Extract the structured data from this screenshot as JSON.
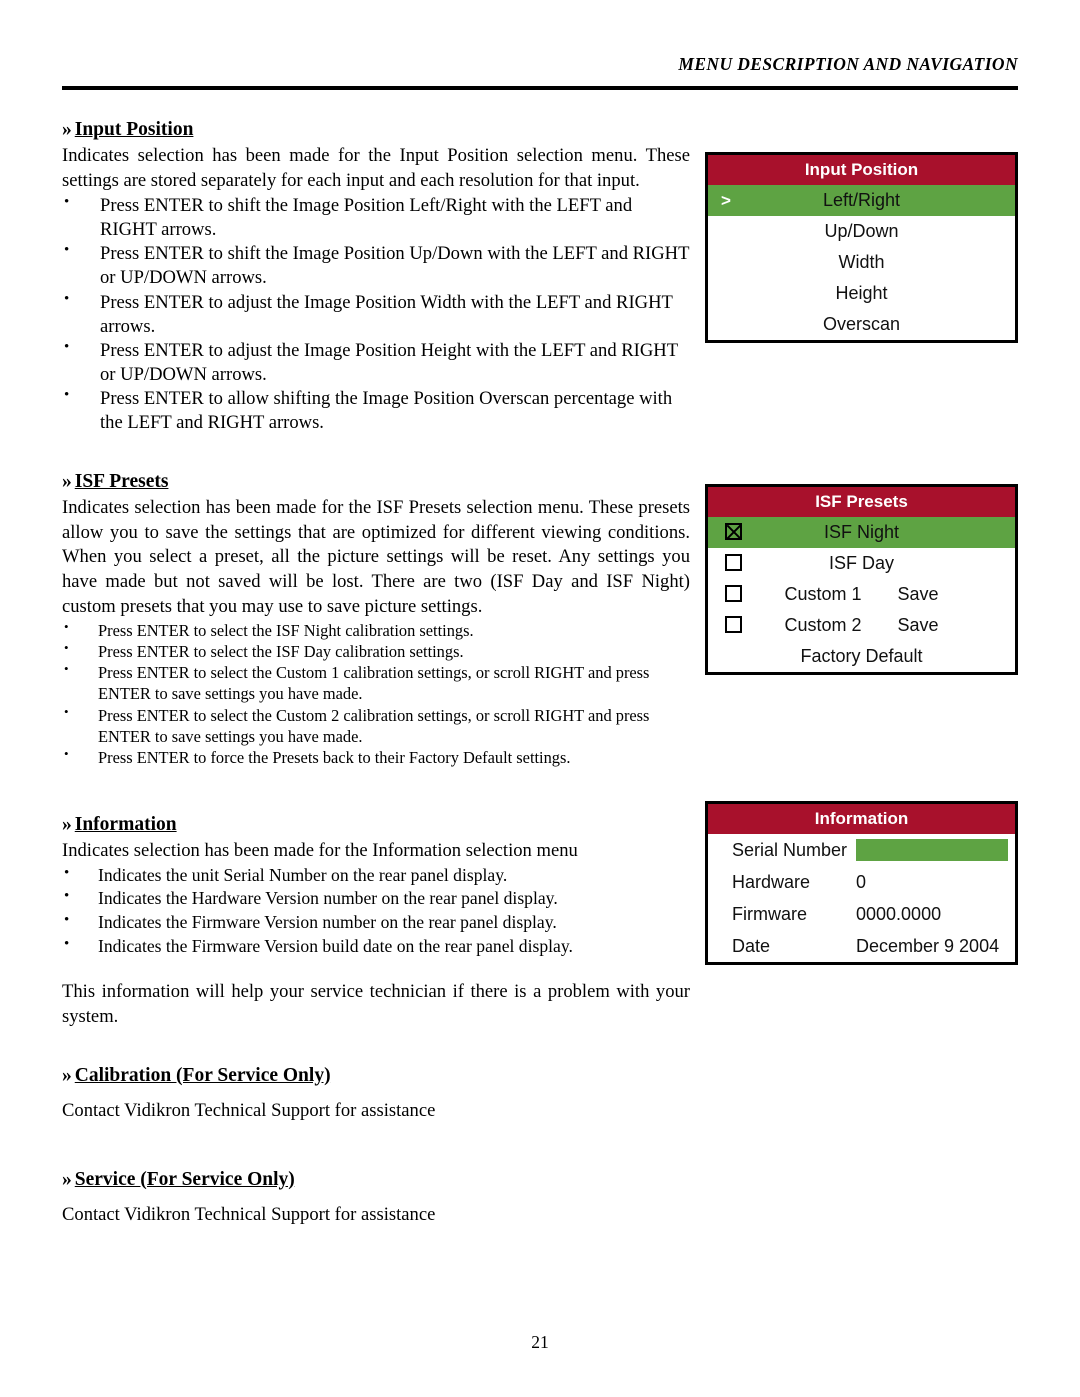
{
  "header": {
    "running_head": "MENU DESCRIPTION AND NAVIGATION"
  },
  "page_number": "21",
  "colors": {
    "osd_title_bg": "#A8112C",
    "osd_selected_bg": "#5EA343",
    "osd_border": "#000000",
    "text": "#000000"
  },
  "sections": {
    "input_position": {
      "guillemet": "»",
      "heading": "Input Position",
      "intro": "Indicates selection has been made for the Input Position selection menu. These settings are stored separately for each input and each resolution for that input.",
      "bullets": [
        "Press ENTER to shift the Image Position Left/Right with the LEFT and RIGHT arrows.",
        "Press ENTER to shift the Image Position Up/Down with the LEFT and RIGHT or UP/DOWN arrows.",
        "Press ENTER to adjust the Image Position Width with the LEFT and RIGHT arrows.",
        "Press ENTER to adjust the Image Position Height with the LEFT and RIGHT or UP/DOWN arrows.",
        "Press ENTER to allow shifting the Image Position Overscan percentage with the LEFT and RIGHT arrows."
      ]
    },
    "isf_presets": {
      "guillemet": "»",
      "heading": "ISF Presets",
      "intro": "Indicates selection has been made for the ISF Presets selection menu. These presets allow you to save the settings that are optimized for different viewing conditions. When you select a preset, all the picture settings will be reset. Any settings you have made but not saved will be lost. There are two (ISF Day and ISF Night) custom presets that you may use to save picture settings.",
      "bullets": [
        "Press ENTER to select the ISF Night calibration settings.",
        "Press ENTER to select the ISF Day calibration settings.",
        "Press ENTER to select the Custom 1 calibration settings, or scroll RIGHT and press ENTER to save settings you have made.",
        "Press ENTER to select the Custom 2 calibration settings, or scroll RIGHT and press ENTER to save settings you have made.",
        "Press ENTER to force the Presets back to their Factory Default settings."
      ]
    },
    "information": {
      "guillemet": "»",
      "heading": "Information",
      "intro": "Indicates selection has been made for the Information selection menu",
      "bullets": [
        "Indicates the unit Serial Number on the rear panel display.",
        "Indicates the Hardware Version number on the rear panel display.",
        "Indicates the Firmware Version number on the rear panel display.",
        "Indicates the Firmware Version build date on the rear panel display."
      ],
      "closing": "This information will help your service technician if there is a problem with your system."
    },
    "calibration": {
      "guillemet": "»",
      "heading": "Calibration (For Service Only)",
      "body": "Contact Vidikron Technical Support for assistance"
    },
    "service": {
      "guillemet": "»",
      "heading": "Service (For Service Only)",
      "body": "Contact Vidikron Technical Support for assistance"
    }
  },
  "osd": {
    "input_position": {
      "title": "Input Position",
      "selected_marker": ">",
      "rows": [
        {
          "label": "Left/Right",
          "selected": true
        },
        {
          "label": "Up/Down",
          "selected": false
        },
        {
          "label": "Width",
          "selected": false
        },
        {
          "label": "Height",
          "selected": false
        },
        {
          "label": "Overscan",
          "selected": false
        }
      ]
    },
    "isf_presets": {
      "title": "ISF Presets",
      "rows": [
        {
          "label": "ISF Night",
          "checkbox": true,
          "checked": true,
          "selected": true,
          "action": ""
        },
        {
          "label": "ISF Day",
          "checkbox": true,
          "checked": false,
          "selected": false,
          "action": ""
        },
        {
          "label": "Custom 1",
          "checkbox": true,
          "checked": false,
          "selected": false,
          "action": "Save"
        },
        {
          "label": "Custom 2",
          "checkbox": true,
          "checked": false,
          "selected": false,
          "action": "Save"
        },
        {
          "label": "Factory Default",
          "checkbox": false,
          "checked": false,
          "selected": false,
          "action": ""
        }
      ]
    },
    "information": {
      "title": "Information",
      "rows": [
        {
          "label": "Serial Number",
          "value": "",
          "green_bar": true
        },
        {
          "label": "Hardware",
          "value": "0",
          "green_bar": false
        },
        {
          "label": "Firmware",
          "value": "0000.0000",
          "green_bar": false
        },
        {
          "label": "Date",
          "value": "December 9  2004",
          "green_bar": false
        }
      ]
    }
  }
}
